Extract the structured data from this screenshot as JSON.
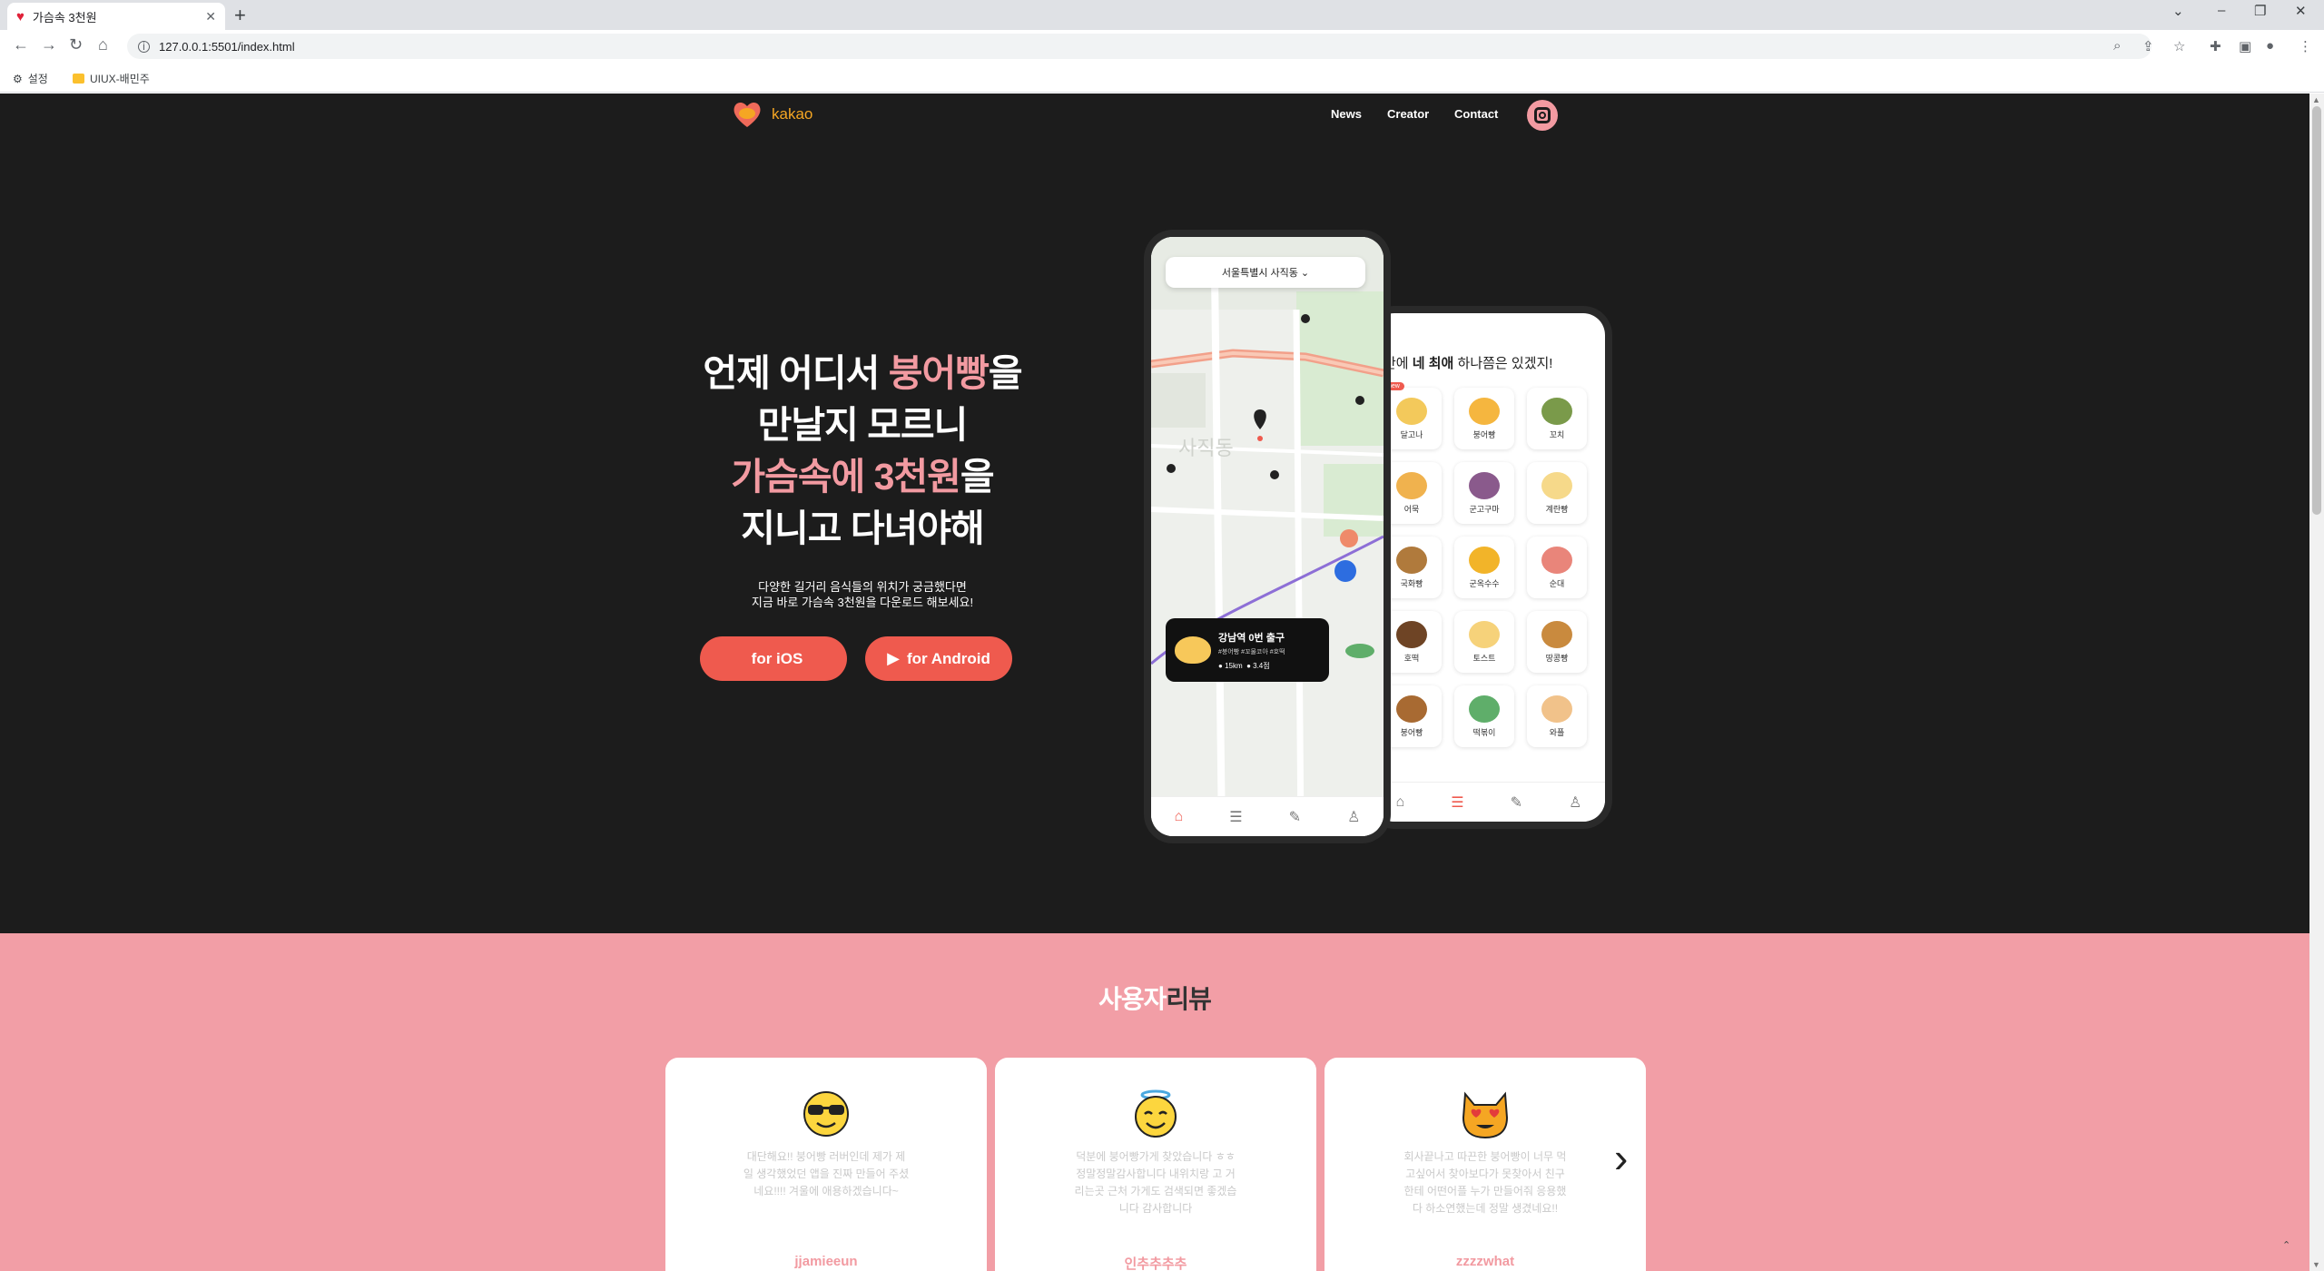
{
  "browser": {
    "tab_title": "가슴속 3천원",
    "tab_close": "✕",
    "new_tab": "+",
    "url": "127.0.0.1:5501/index.html",
    "bookmarks": [
      {
        "label": "설정"
      },
      {
        "label": "UIUX-배민주"
      }
    ]
  },
  "header": {
    "logo_text": "kakao",
    "nav": [
      {
        "label": "News"
      },
      {
        "label": "Creator"
      },
      {
        "label": "Contact"
      }
    ]
  },
  "hero": {
    "line1_a": "언제 어디서 ",
    "line1_b": "붕어빵",
    "line1_c": "을",
    "line2": "만날지 모르니",
    "line3_a": "가슴속에 3천원",
    "line3_b": "을",
    "line4": "지니고 다녀야해",
    "sub1": "다양한 길거리 음식들의 위치가 궁금했다면",
    "sub2": "지금 바로 가슴속 3천원을 다운로드 해보세요!",
    "btn_ios": "for iOS",
    "btn_android": "for Android"
  },
  "phone_map": {
    "location": "서울특별시 사직동 ⌄",
    "map_label": "사직동",
    "store_name": "강남역 0번 출구",
    "store_tags": "#붕어빵 #꼬물코아 #호떡",
    "store_dist": "15km",
    "store_rating": "3.4점"
  },
  "phone_cat": {
    "head_a": "안에 ",
    "head_b": "네 최애",
    "head_c": " 하나쯤은 있겠지!",
    "new_badge": "new",
    "items": [
      {
        "label": "달고나",
        "color": "#f3c95b"
      },
      {
        "label": "붕어빵",
        "color": "#f5b63f"
      },
      {
        "label": "꼬치",
        "color": "#7a9a4a"
      },
      {
        "label": "어묵",
        "color": "#f0b24e"
      },
      {
        "label": "군고구마",
        "color": "#8a5a8c"
      },
      {
        "label": "계란빵",
        "color": "#f6d98a"
      },
      {
        "label": "국화빵",
        "color": "#b07a3c"
      },
      {
        "label": "군옥수수",
        "color": "#f2b429"
      },
      {
        "label": "순대",
        "color": "#e9857a"
      },
      {
        "label": "호떡",
        "color": "#6e4425"
      },
      {
        "label": "토스트",
        "color": "#f6d27a"
      },
      {
        "label": "땅콩빵",
        "color": "#c98a3e"
      },
      {
        "label": "붕어빵",
        "color": "#a86a32"
      },
      {
        "label": "떡볶이",
        "color": "#5fae6a"
      },
      {
        "label": "와플",
        "color": "#f1c28a"
      }
    ]
  },
  "reviews": {
    "title_a": "사용자",
    "title_b": "리뷰",
    "cards": [
      {
        "text": "대단해요!! 붕어빵 러버인데 제가 제일 생각했었던 앱을 진짜 만들어 주셨네요!!!! 겨울에 애용하겠습니다~",
        "user": "jjamieeun",
        "emoji": "sunglasses"
      },
      {
        "text": "덕분에 붕어빵가게 찾았습니다 ㅎㅎ 정말정말감사합니다 내위치랑 고 거리는곳 근처 가게도 검색되면 좋겠습니다 감사합니다",
        "user": "인추추추추",
        "emoji": "halo"
      },
      {
        "text": "회사끝나고 따끈한 붕어빵이 너무 먹고싶어서 찾아보다가 못찾아서 친구한테 어떤어플 누가 만들어줘 응용했다 하소연했는데 정말 생겼네요!!",
        "user": "zzzzwhat",
        "emoji": "heart-eyes-cat"
      }
    ],
    "prev": "‹",
    "next": "›"
  },
  "colors": {
    "accent": "#f29aa1",
    "button": "#ef5a4e",
    "dark_bg": "#1c1c1c",
    "logo": "#f5a623"
  }
}
